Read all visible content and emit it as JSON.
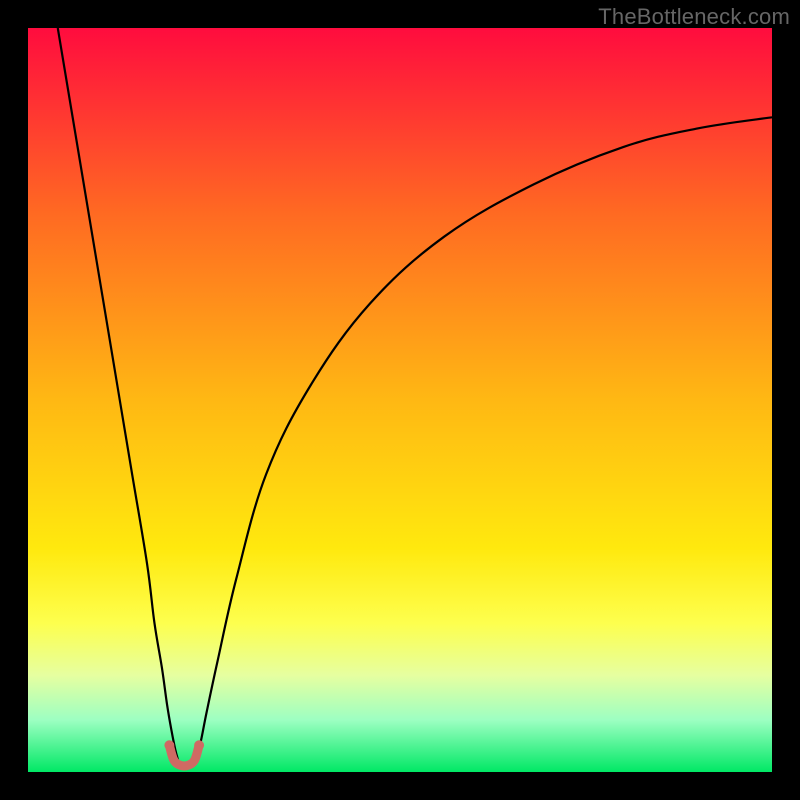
{
  "watermark": "TheBottleneck.com",
  "chart_data": {
    "type": "line",
    "title": "",
    "xlabel": "",
    "ylabel": "",
    "xlim": [
      0,
      100
    ],
    "ylim": [
      0,
      100
    ],
    "grid": false,
    "legend": false,
    "background_gradient": {
      "stops": [
        {
          "offset": 0.0,
          "color": "#ff0c3e"
        },
        {
          "offset": 0.25,
          "color": "#ff6a22"
        },
        {
          "offset": 0.5,
          "color": "#ffb813"
        },
        {
          "offset": 0.7,
          "color": "#ffe90e"
        },
        {
          "offset": 0.8,
          "color": "#fdff4e"
        },
        {
          "offset": 0.87,
          "color": "#e6ffa0"
        },
        {
          "offset": 0.93,
          "color": "#9dffc2"
        },
        {
          "offset": 1.0,
          "color": "#00e865"
        }
      ]
    },
    "series": [
      {
        "name": "left-arm",
        "color": "#000000",
        "width": 2.2,
        "x": [
          4,
          6,
          8,
          10,
          12,
          14,
          16,
          17,
          18,
          18.7,
          19.3,
          19.8,
          20.2
        ],
        "y": [
          100,
          88,
          76,
          64,
          52,
          40,
          28,
          20,
          14,
          9,
          5.5,
          3,
          1.5
        ]
      },
      {
        "name": "right-arm",
        "color": "#000000",
        "width": 2.2,
        "x": [
          22.5,
          23.2,
          24,
          25.5,
          28,
          32,
          38,
          46,
          56,
          68,
          80,
          90,
          100
        ],
        "y": [
          1.5,
          4,
          8,
          15,
          26,
          40,
          52,
          63,
          72,
          79,
          84,
          86.5,
          88
        ]
      },
      {
        "name": "valley-marker",
        "color": "#cf6a63",
        "width": 9,
        "linecap": "round",
        "x": [
          19.0,
          19.6,
          20.5,
          21.5,
          22.4,
          23.0
        ],
        "y": [
          3.6,
          1.6,
          0.9,
          0.9,
          1.6,
          3.6
        ]
      }
    ],
    "annotations": []
  }
}
